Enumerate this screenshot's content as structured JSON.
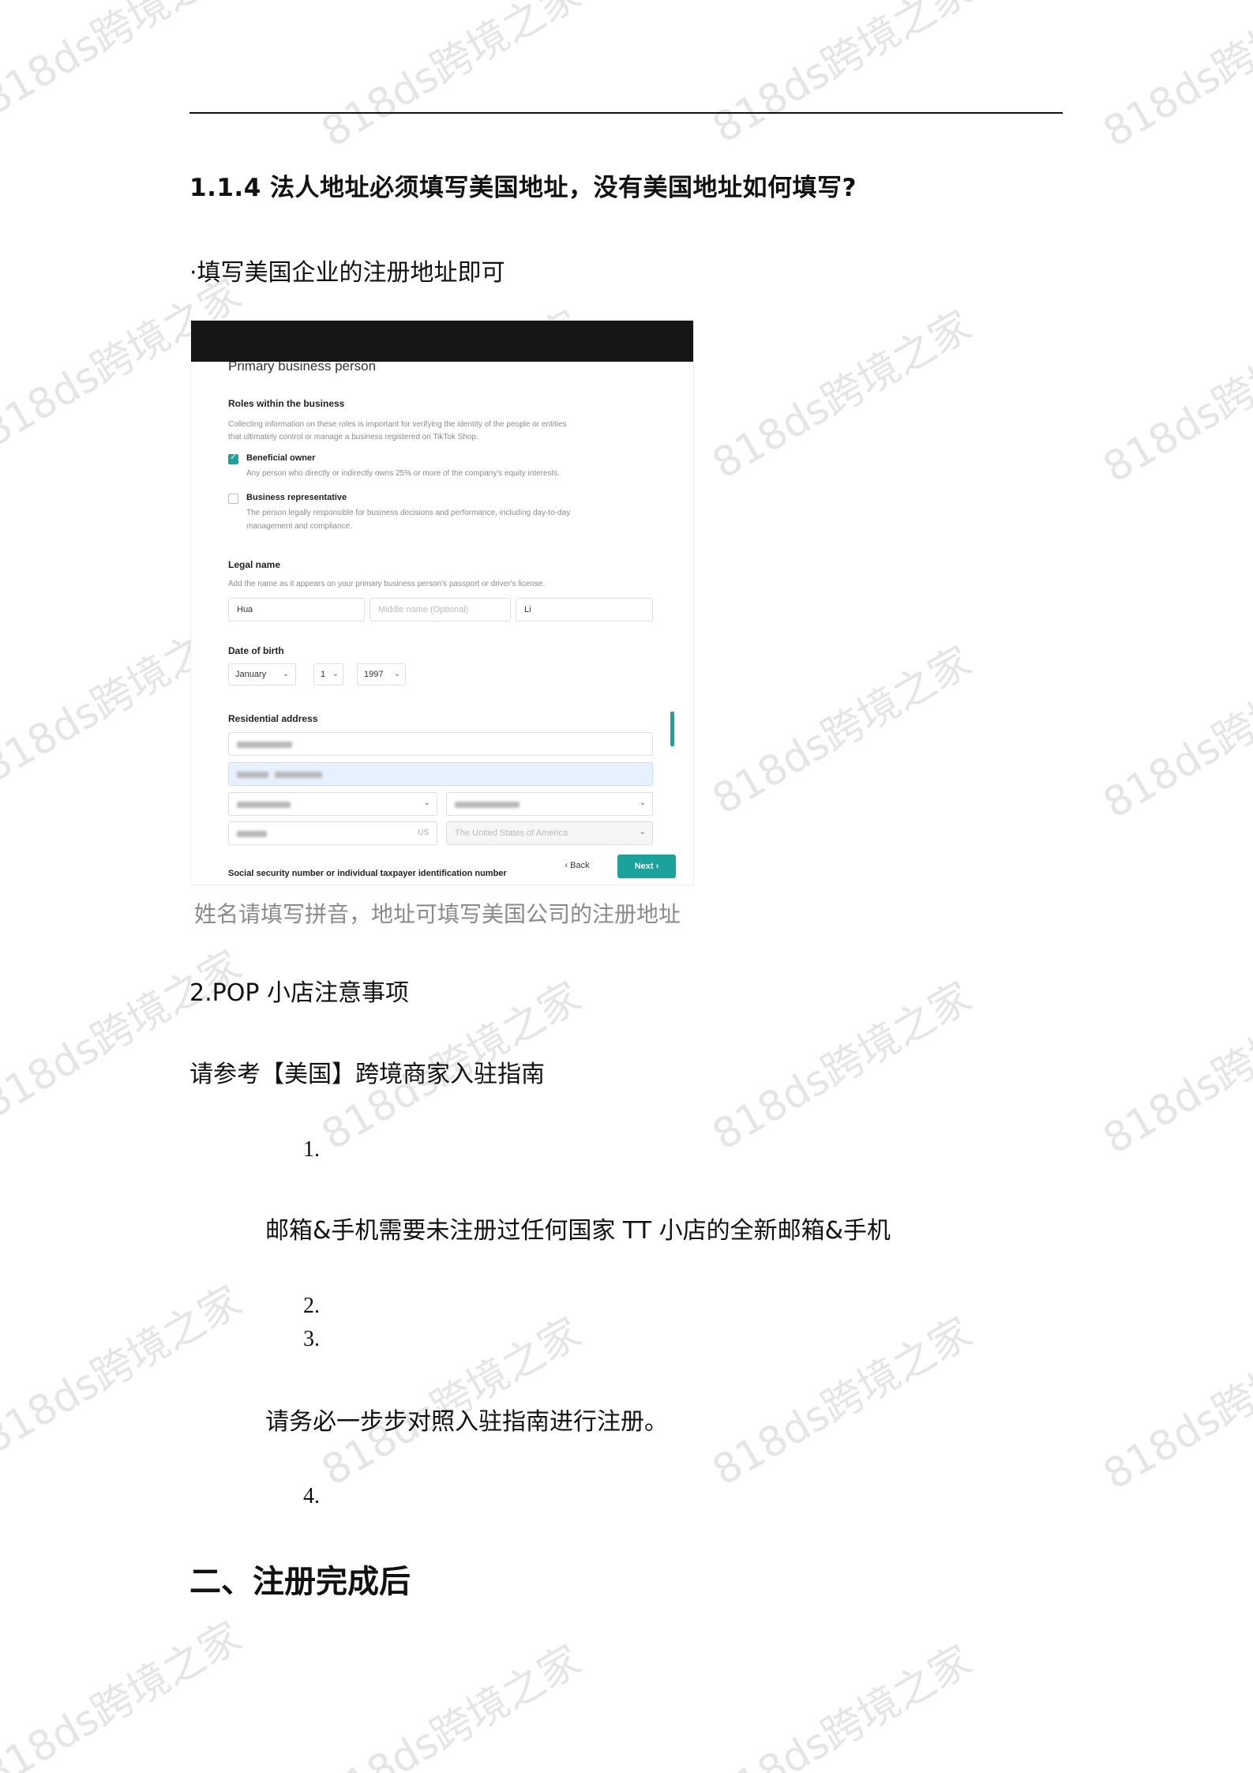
{
  "heading_114": "1.1.4 法人地址必须填写美国地址，没有美国地址如何填写?",
  "bullet_fill_address": "·填写美国企业的注册地址即可",
  "figure": {
    "title": "Primary business person",
    "roles_heading": "Roles within the business",
    "roles_desc_1": "Collecting information on these roles is important for verifying the identity of the people or entities",
    "roles_desc_2": "that ultimately control or manage a business registered on TikTok Shop.",
    "beneficial_owner_label": "Beneficial owner",
    "beneficial_owner_desc": "Any person who directly or indirectly owns 25% or more of the company's equity interests.",
    "business_rep_label": "Business representative",
    "business_rep_desc_1": "The person legally responsible for business decisions and performance, including day-to-day",
    "business_rep_desc_2": "management and compliance.",
    "legal_name_heading": "Legal name",
    "legal_name_desc": "Add the name as it appears on your primary business person's passport or driver's license.",
    "first_name_value": "Hua",
    "middle_name_placeholder": "Middle name (Optional)",
    "last_name_value": "Li",
    "dob_heading": "Date of birth",
    "dob_month": "January",
    "dob_day": "1",
    "dob_year": "1997",
    "address_heading": "Residential address",
    "postal_suffix": "US",
    "country_value": "The United States of America",
    "ssn_label": "Social security number or individual taxpayer identification number",
    "back_button": "‹ Back",
    "next_button": "Next ›"
  },
  "figure_caption": "姓名请填写拼音，地址可填写美国公司的注册地址",
  "section_pop": "2.POP 小店注意事项",
  "refer_guide": "请参考【美国】跨境商家入驻指南",
  "list": {
    "n1": "1.",
    "item1_text": "邮箱&手机需要未注册过任何国家 TT 小店的全新邮箱&手机",
    "n2": "2.",
    "n3": "3.",
    "item3_text": "请务必一步步对照入驻指南进行注册。",
    "n4": "4."
  },
  "heading_after_register": "二、注册完成后",
  "watermark_text": "818ds跨境之家",
  "colors": {
    "teal_accent": "#1aa39a",
    "caption_gray": "#8a8a8a",
    "bar_dark": "#161616"
  }
}
